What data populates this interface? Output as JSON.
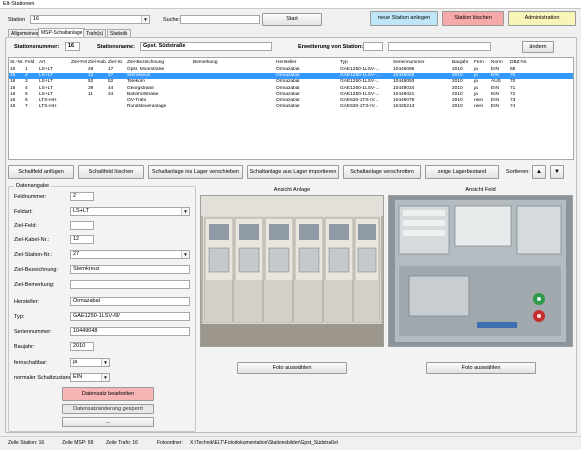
{
  "window": {
    "title": "Elt-Stationen"
  },
  "top": {
    "station_label": "Station",
    "station_value": "16",
    "search_label": "Suche:",
    "search_value": "",
    "start_button": "Start",
    "new_station_button": "neue Station anlegen",
    "delete_station_button": "Station löschen",
    "admin_button": "Administration"
  },
  "tabs": [
    "Allgemeines",
    "MSP-Schaltanlage",
    "Trafo(s)",
    "Statistik"
  ],
  "info": {
    "station_number_label": "Stationsnummer:",
    "station_number_value": "16",
    "station_name_label": "Stationsname:",
    "station_name_value": "Gpst. Südstraße",
    "extension_label": "Erweiterung von Station:",
    "extension_value1": "",
    "extension_value2": "",
    "change_button": "ändern"
  },
  "table": {
    "columns": [
      "St.-Nr.",
      "Feld",
      "Art",
      "Ziel-Feld",
      "Ziel-Kab.",
      "Ziel-St.",
      "Ziel-Bezeichnung",
      "Bemerkung",
      "Hersteller",
      "Typ",
      "Seriennummer",
      "Baujahr",
      "Fern",
      "Norm",
      "DBZ-Nr."
    ],
    "rows": [
      [
        "16",
        "1",
        "LS+LT",
        "",
        "48",
        "17",
        "Gpst. Moorstraße",
        "",
        "Ormazabal",
        "GAE1250-1LSV-...",
        "10449096",
        "2010",
        "ja",
        "EIN",
        "68"
      ],
      [
        "16",
        "2",
        "LS+LT",
        "",
        "12",
        "27",
        "Sternkreuz",
        "",
        "Ormazabal",
        "GAE1250-1LSV-...",
        "10449048",
        "2010",
        "ja",
        "EIN",
        "70"
      ],
      [
        "16",
        "3",
        "LS+LT",
        "",
        "52",
        "52",
        "Telekom",
        "",
        "Ormazabal",
        "GAE1250-1LSV-...",
        "10449093",
        "2010",
        "ja",
        "AUS",
        "70"
      ],
      [
        "16",
        "4",
        "LS+LT",
        "",
        "39",
        "44",
        "Georgstraße",
        "",
        "Ormazabal",
        "GAE1250-1LSV-...",
        "10449034",
        "2010",
        "ja",
        "EIN",
        "71"
      ],
      [
        "16",
        "5",
        "LS+LT",
        "",
        "11",
        "24",
        "Bahnhofstraße",
        "",
        "Ormazabal",
        "GAE1250-1LSV-...",
        "10449021",
        "2010",
        "ja",
        "EIN",
        "72"
      ],
      [
        "16",
        "6",
        "LTS-mH",
        "",
        "",
        "",
        "OV-Trafo",
        "",
        "Ormazabal",
        "GAE630-1TS-/V...",
        "10449076",
        "2010",
        "nein",
        "EIN",
        "73"
      ],
      [
        "16",
        "7",
        "LTS-mH",
        "",
        "",
        "",
        "Rundsteueranlage",
        "",
        "Ormazabal",
        "GAE630-1TS-/V...",
        "10425213",
        "2010",
        "nein",
        "EIN",
        "74"
      ]
    ]
  },
  "actions": {
    "add": "Schaltfeld anfügen",
    "delete": "Schaltfeld löschen",
    "move_to_store": "Schaltanlage ins Lager verschieben",
    "import_from_store": "Schaltanlage aus Lager importieren",
    "scrap": "Schaltanlage verschrotten",
    "show_store": "zeige Lagerbestand",
    "sort_label": "Sortieren:",
    "sort_up": "▲",
    "sort_down": "▼"
  },
  "form": {
    "group_title": "Datenangabe",
    "fields": [
      {
        "label": "Feldnummer:",
        "value": "2",
        "type": "input"
      },
      {
        "label": "Feldart:",
        "value": "LS+LT",
        "type": "combo"
      },
      {
        "label": "Ziel-Feld:",
        "value": "",
        "type": "input"
      },
      {
        "label": "Ziel-Kabel-Nr.:",
        "value": "12",
        "type": "input"
      },
      {
        "label": "Ziel-Station-Nr.:",
        "value": "27",
        "type": "combo"
      },
      {
        "label": "Ziel-Bezeichnung:",
        "value": "Sternkreuz",
        "type": "input"
      },
      {
        "label": "Ziel-Bemerkung:",
        "value": "",
        "type": "input"
      },
      {
        "label": "Hersteller:",
        "value": "Ormazabal",
        "type": "input"
      },
      {
        "label": "Typ:",
        "value": "GAE1250-1LSV-/8/",
        "type": "input"
      },
      {
        "label": "Seriennummer:",
        "value": "10449048",
        "type": "input"
      },
      {
        "label": "Baujahr:",
        "value": "2010",
        "type": "input"
      },
      {
        "label": "fernschaltbar:",
        "value": "ja",
        "type": "combo"
      },
      {
        "label": "normaler Schaltzustand:",
        "value": "EIN",
        "type": "combo"
      }
    ],
    "edit_button": "Datensatz bearbeiten",
    "locked_text": "Datensatzänderung gesperrt",
    "dots_button": "..."
  },
  "views": {
    "left_title": "Ansicht Anlage",
    "right_title": "Ansicht Feld",
    "left_photo_button": "Foto auswählen",
    "right_photo_button": "Foto auswählen"
  },
  "status": {
    "station_count": "Zeile Station:  16",
    "msp_count": "Zeile MSP:  69",
    "trafo_count": "Zeile Trafo:  16",
    "photo_label": "Fotoordner:",
    "photo_path": "X:\\Technik\\ELT\\Fotodokumentation\\Stationsbilder\\Gpst_Südstraße\\"
  },
  "colors": {
    "new_station": "#bfe6f7",
    "delete_station": "#f5a9a9",
    "administration": "#f9f4b8",
    "edit_button": "#f6b4b4",
    "selection": "#3399ff"
  }
}
